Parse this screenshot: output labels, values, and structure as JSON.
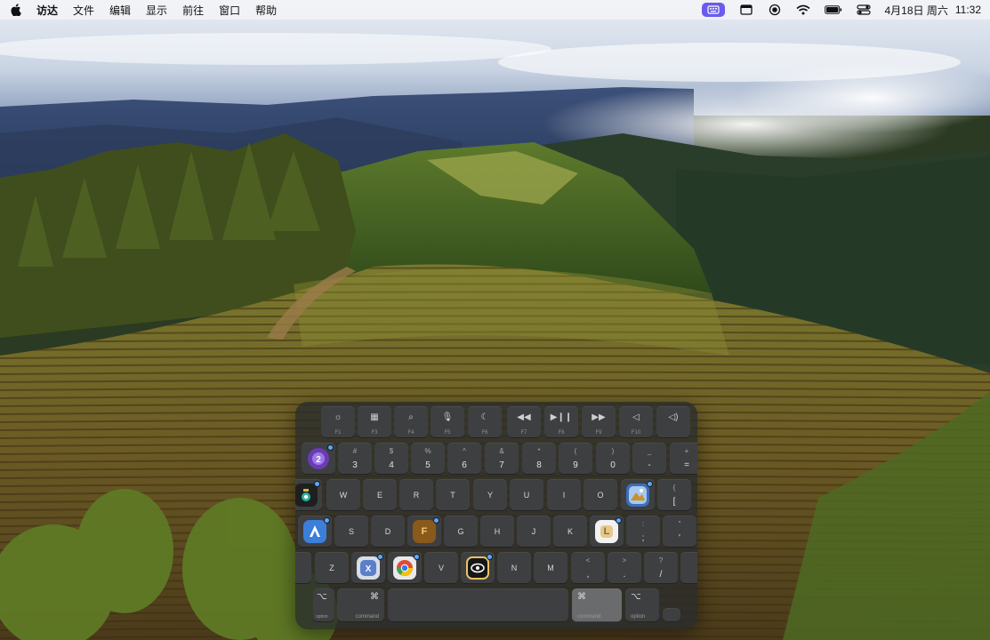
{
  "menubar": {
    "app_name": "访达",
    "menus": [
      "文件",
      "编辑",
      "显示",
      "前往",
      "窗口",
      "帮助"
    ],
    "date": "4月18日 周六",
    "time": "11:32"
  },
  "status_icons": [
    "input-method-icon",
    "window-icon",
    "record-icon",
    "wifi-icon",
    "battery-icon",
    "control-center-icon"
  ],
  "keyboard": {
    "fn_row": [
      {
        "glyph": "☼",
        "label": "F1"
      },
      {
        "glyph": "▦",
        "label": "F3"
      },
      {
        "glyph": "⌕",
        "label": "F4"
      },
      {
        "glyph": "🎙",
        "label": "F5"
      },
      {
        "glyph": "☾",
        "label": "F6"
      },
      {
        "glyph": "◀◀",
        "label": "F7"
      },
      {
        "glyph": "▶❙❙",
        "label": "F8"
      },
      {
        "glyph": "▶▶",
        "label": "F9"
      },
      {
        "glyph": "◁",
        "label": "F10"
      },
      {
        "glyph": "◁)",
        "label": ""
      }
    ],
    "num_row": [
      {
        "main": "3",
        "sub": "#"
      },
      {
        "main": "4",
        "sub": "$"
      },
      {
        "main": "5",
        "sub": "%"
      },
      {
        "main": "6",
        "sub": "^"
      },
      {
        "main": "7",
        "sub": "&"
      },
      {
        "main": "8",
        "sub": "*"
      },
      {
        "main": "9",
        "sub": "("
      },
      {
        "main": "0",
        "sub": ")"
      },
      {
        "main": "-",
        "sub": "_"
      },
      {
        "main": "=",
        "sub": "+"
      }
    ],
    "q_row": [
      "W",
      "E",
      "R",
      "T",
      "Y",
      "U",
      "I",
      "O"
    ],
    "bracket_key": {
      "main": "[",
      "sub": "{"
    },
    "a_row": [
      "S",
      "D",
      "G",
      "H",
      "J",
      "K"
    ],
    "semicolon_key": {
      "main": ";",
      "sub": ":"
    },
    "quote_key": {
      "main": "'",
      "sub": "\""
    },
    "z_row": [
      "Z",
      "V",
      "N",
      "M"
    ],
    "comma_key": {
      "main": ",",
      "sub": "<"
    },
    "period_key": {
      "main": ".",
      "sub": ">"
    },
    "slash_key": {
      "main": "/",
      "sub": "?"
    },
    "bottom": {
      "option_left": {
        "glyph": "⌥",
        "label": "option"
      },
      "command_left": {
        "glyph": "⌘",
        "label": "command"
      },
      "command_right": {
        "glyph": "⌘",
        "label": "command"
      },
      "option_right": {
        "glyph": "⌥",
        "label": "option"
      }
    },
    "apps": {
      "key_2": {
        "text": "2",
        "color": "#6b3bb4"
      },
      "key_q": {
        "text": "",
        "color": "#1f1f1f"
      },
      "key_p": {
        "text": "",
        "color": "#3b6fb8"
      },
      "key_a": {
        "text": "A",
        "color": "#3b7fd9"
      },
      "key_f": {
        "text": "F",
        "color": "#8a5a1a"
      },
      "key_l": {
        "text": "L",
        "color": "#f2f2f2"
      },
      "key_x": {
        "text": "X",
        "color": "#5c7fc9"
      },
      "key_c": {
        "text": "C",
        "color": "#2f8fd9"
      },
      "key_b": {
        "text": "",
        "color": "#161616"
      }
    }
  }
}
